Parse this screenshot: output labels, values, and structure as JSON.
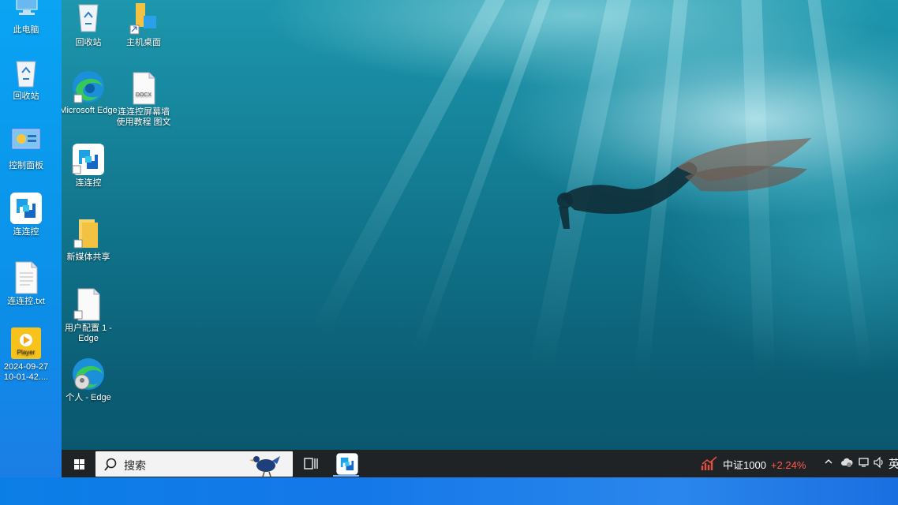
{
  "outer_desktop": {
    "icons": [
      {
        "label": "此电脑",
        "icon": "computer-icon"
      },
      {
        "label": "回收站",
        "icon": "recycle-bin-icon"
      },
      {
        "label": "控制面板",
        "icon": "control-panel-icon"
      },
      {
        "label": "连连控",
        "icon": "lianliankong-icon"
      },
      {
        "label": "连连控.txt",
        "icon": "text-file-icon"
      },
      {
        "label": "2024-09-27 10-01-42....",
        "icon": "player-video-icon"
      }
    ]
  },
  "remote_desktop": {
    "icons": [
      {
        "label": "回收站",
        "icon": "recycle-bin-icon"
      },
      {
        "label": "主机桌面",
        "icon": "folder-shortcut-icon"
      },
      {
        "label": "Microsoft Edge",
        "icon": "edge-icon"
      },
      {
        "label": "连连控屏幕墙使用教程 图文",
        "icon": "docx-file-icon"
      },
      {
        "label": "连连控",
        "icon": "lianliankong-icon"
      },
      {
        "label": "新媒体共享",
        "icon": "folder-icon"
      },
      {
        "label": "用户配置 1 - Edge",
        "icon": "file-icon"
      },
      {
        "label": "个人 - Edge",
        "icon": "edge-profile-icon"
      }
    ],
    "wallpaper": "underwater-diver"
  },
  "taskbar": {
    "search_placeholder": "搜索",
    "stock_name": "中证1000",
    "stock_change": "+2.24%",
    "language": "英",
    "colors": {
      "bar": "#1f2326",
      "stock_up": "#ff5a4a"
    }
  }
}
